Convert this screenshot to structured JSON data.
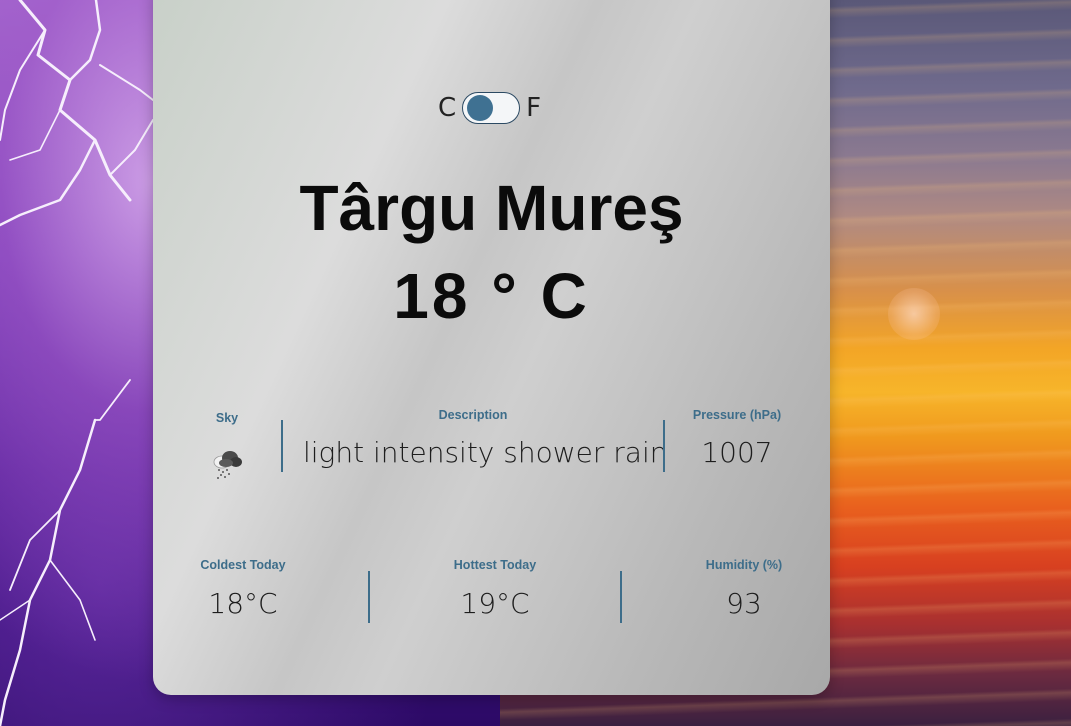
{
  "toggle": {
    "left_unit": "C",
    "right_unit": "F",
    "selected": "C"
  },
  "location": {
    "city": "Târgu Mureş"
  },
  "current": {
    "temperature": "18 ° C"
  },
  "row1": {
    "sky_label": "Sky",
    "sky_icon": "rain-shower-cloud-icon",
    "description_label": "Description",
    "description_value": "light intensity shower rain",
    "pressure_label": "Pressure (hPa)",
    "pressure_value": "1007"
  },
  "row2": {
    "coldest_label": "Coldest Today",
    "coldest_value": "18°C",
    "hottest_label": "Hottest Today",
    "hottest_value": "19°C",
    "humidity_label": "Humidity (%)",
    "humidity_value": "93"
  },
  "colors": {
    "accent": "#3d6d8a",
    "toggle_knob": "#3f7192",
    "text": "#0b0b0b"
  }
}
